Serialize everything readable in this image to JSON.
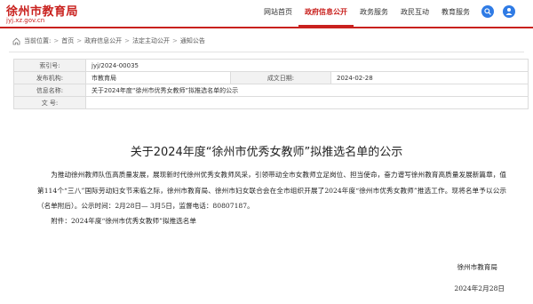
{
  "header": {
    "title": "徐州市教育局",
    "url": "jyj.xz.gov.cn",
    "nav": [
      "网站首页",
      "政府信息公开",
      "政务服务",
      "政民互动",
      "教育服务"
    ],
    "active_nav": "政府信息公开",
    "accent_color": "#c9211e",
    "search_icon": "search-icon",
    "user_icon": "user-icon"
  },
  "breadcrumb": {
    "prefix": "当前位置:",
    "items": [
      "首页",
      "政府信息公开",
      "法定主动公开",
      "通知公告"
    ]
  },
  "info": {
    "index_label": "索引号:",
    "index_value": "jyj/2024-00035",
    "publisher_label": "发布机构:",
    "publisher_value": "市教育局",
    "date_label": "成文日期:",
    "date_value": "2024-02-28",
    "name_label": "信息名称:",
    "name_value": "关于2024年度“徐州市优秀女教师”拟推选名单的公示",
    "docno_label": "文 号:",
    "docno_value": ""
  },
  "document": {
    "title": "关于2024年度“徐州市优秀女教师”拟推选名单的公示",
    "body": "为推动徐州教师队伍高质量发展，展现新时代徐州优秀女教师风采，引领带动全市女教师立足岗位、担当使命，奋力谱写徐州教育高质量发展新篇章，值第114个“三八”国际劳动妇女节来临之际，徐州市教育局、徐州市妇女联合会在全市组织开展了2024年度“徐州市优秀女教师”推选工作。现将名单予以公示（名单附后）。公示时间：2月28日— 3月5日，监督电话：80807187。",
    "attachment": "附件：2024年度“徐州市优秀女教师”拟推选名单",
    "signature_org": "徐州市教育局",
    "signature_date": "2024年2月28日"
  }
}
